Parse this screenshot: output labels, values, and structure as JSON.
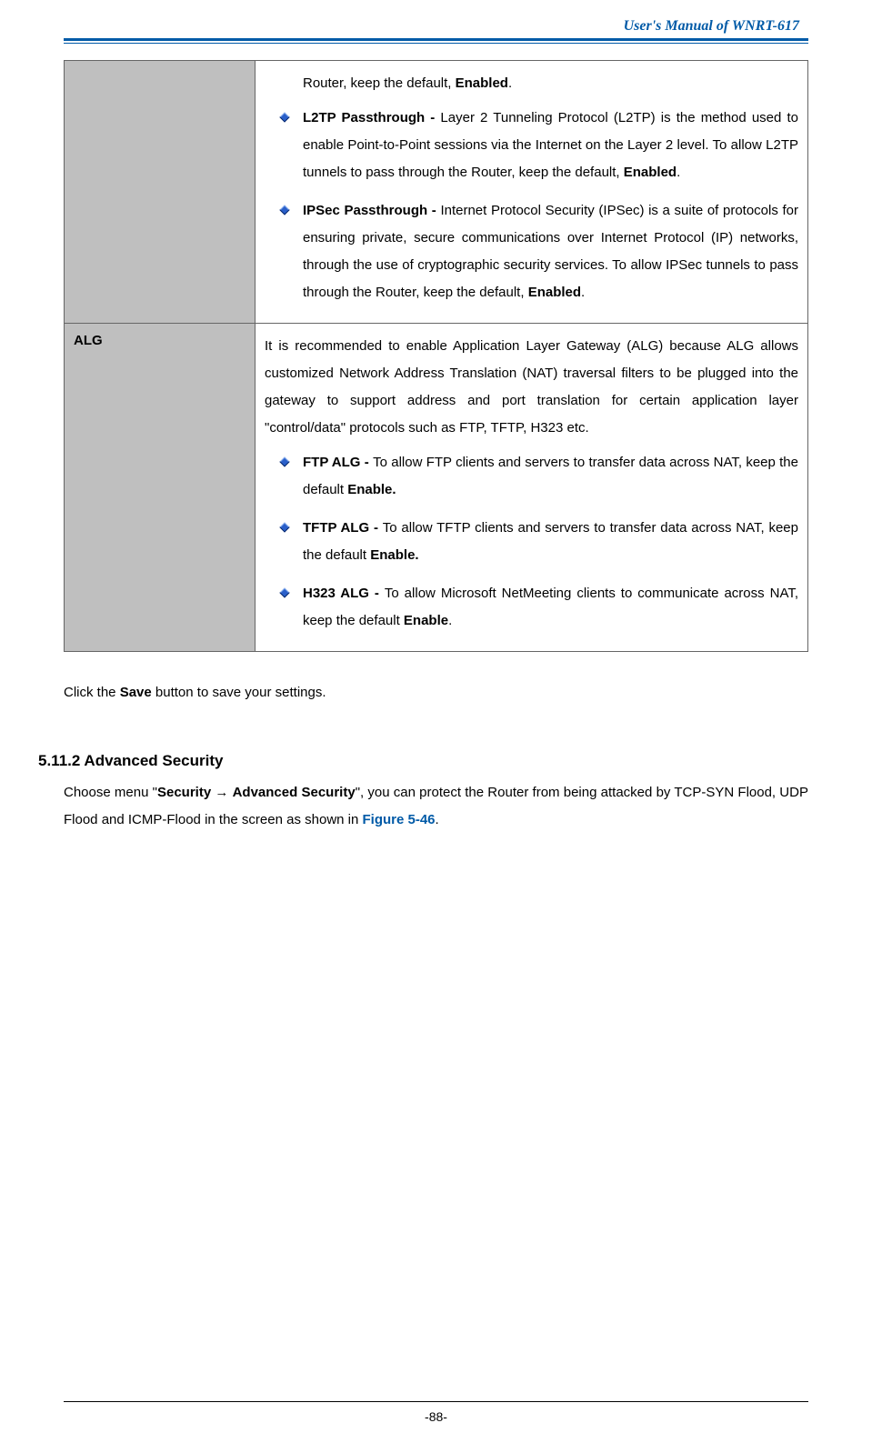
{
  "header": {
    "title": "User's Manual of WNRT-617"
  },
  "table": {
    "row1": {
      "label": "",
      "intro_tail": "Router, keep the default, ",
      "intro_bold": "Enabled",
      "intro_period": ".",
      "items": [
        {
          "title": "L2TP Passthrough - ",
          "text_a": "Layer 2 Tunneling Protocol (L2TP) is the method used to enable Point-to-Point sessions via the Internet on the Layer 2 level. To allow L2TP tunnels to pass through the Router, keep the default, ",
          "bold": "Enabled",
          "tail": "."
        },
        {
          "title": "IPSec Passthrough - ",
          "text_a": "Internet Protocol Security (IPSec) is a suite of protocols for ensuring private, secure communications over Internet Protocol (IP) networks, through the use of cryptographic security services. To allow IPSec tunnels to pass through the Router, keep the default, ",
          "bold": "Enabled",
          "tail": "."
        }
      ]
    },
    "row2": {
      "label": "ALG",
      "intro": "It is recommended to enable Application Layer Gateway (ALG) because ALG allows customized Network Address Translation (NAT) traversal filters to be plugged into the gateway to support address and port translation for certain application layer \"control/data\" protocols such as FTP, TFTP, H323 etc.",
      "items": [
        {
          "title": "FTP ALG - ",
          "text_a": "To allow FTP clients and servers to transfer data across NAT, keep the default ",
          "bold": "Enable.",
          "tail": ""
        },
        {
          "title": "TFTP ALG - ",
          "text_a": "To allow TFTP clients and servers to transfer data across NAT, keep the default ",
          "bold": "Enable.",
          "tail": ""
        },
        {
          "title": "H323 ALG - ",
          "text_a": "To allow Microsoft NetMeeting clients to communicate across NAT, keep the default ",
          "bold": "Enable",
          "tail": "."
        }
      ]
    }
  },
  "after_table": {
    "pre": "Click the ",
    "bold": "Save",
    "post": " button to save your settings."
  },
  "subsection": {
    "heading": "5.11.2 Advanced Security",
    "text_a": "Choose menu \"",
    "nav_bold1": "Security",
    "nav_arrow": " → ",
    "nav_bold2": "Advanced Security",
    "text_b": "\", you can protect the Router from being attacked by TCP-SYN Flood, UDP Flood and ICMP-Flood in the screen as shown in ",
    "fig_ref": "Figure 5-46",
    "tail": "."
  },
  "footer": {
    "page_number": "-88-"
  }
}
